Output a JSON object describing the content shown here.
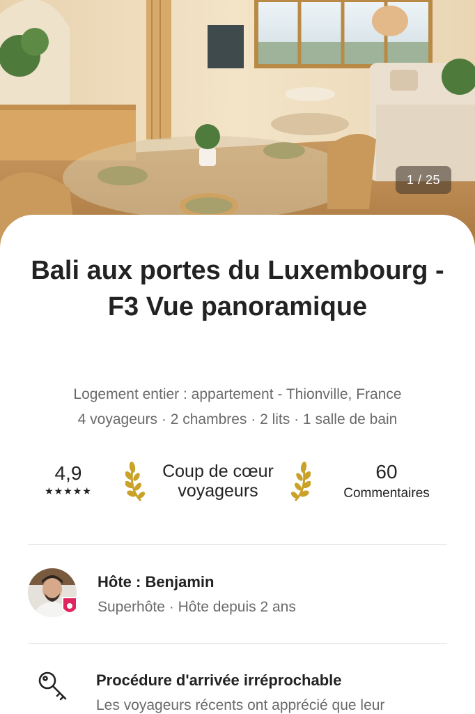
{
  "photo": {
    "counter": "1 / 25"
  },
  "listing": {
    "title": "Bali aux portes du Luxembourg - F3 Vue panoramique",
    "type_location": "Logement entier : appartement - Thionville, France",
    "capacity": "4 voyageurs · 2 chambres · 2 lits · 1 salle de bain"
  },
  "stats": {
    "rating": "4,9",
    "stars": "★★★★★",
    "favorite_label": "Coup de cœur voyageurs",
    "reviews_count": "60",
    "reviews_label": "Commentaires"
  },
  "host": {
    "name_line": "Hôte : Benjamin",
    "meta": "Superhôte · Hôte depuis 2 ans"
  },
  "highlights": [
    {
      "icon": "key-icon",
      "title": "Procédure d'arrivée irréprochable",
      "description": "Les voyageurs récents ont apprécié que leur"
    }
  ],
  "colors": {
    "text_primary": "#222222",
    "text_secondary": "#6a6a6a",
    "laurel_gold": "#c9a227",
    "superhost_badge": "#e0245e",
    "divider": "#dddddd"
  }
}
